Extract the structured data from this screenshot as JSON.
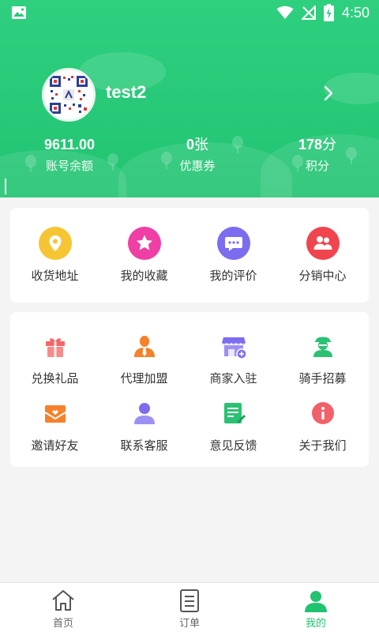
{
  "status_bar": {
    "time": "4:50"
  },
  "profile": {
    "username": "test2"
  },
  "stats": [
    {
      "value": "9611.00",
      "unit": "",
      "label": "账号余额"
    },
    {
      "value": "0",
      "unit": "张",
      "label": "优惠券"
    },
    {
      "value": "178",
      "unit": "分",
      "label": "积分"
    }
  ],
  "menu_primary": [
    {
      "label": "收货地址",
      "icon": "location-icon",
      "color": "#f5c533"
    },
    {
      "label": "我的收藏",
      "icon": "star-icon",
      "color": "#f03fa4"
    },
    {
      "label": "我的评价",
      "icon": "comment-icon",
      "color": "#7b6cf0"
    },
    {
      "label": "分销中心",
      "icon": "users-icon",
      "color": "#f0444f"
    }
  ],
  "menu_secondary": [
    {
      "label": "兑换礼品",
      "icon": "gift-icon",
      "color": "#f66565"
    },
    {
      "label": "代理加盟",
      "icon": "agent-icon",
      "color": "#f5812b"
    },
    {
      "label": "商家入驻",
      "icon": "shop-icon",
      "color": "#7b6cf0"
    },
    {
      "label": "骑手招募",
      "icon": "rider-icon",
      "color": "#2bc173"
    },
    {
      "label": "邀请好友",
      "icon": "invite-mail-icon",
      "color": "#f5812b"
    },
    {
      "label": "联系客服",
      "icon": "service-icon",
      "color": "#7b6cf0"
    },
    {
      "label": "意见反馈",
      "icon": "feedback-icon",
      "color": "#2bc173"
    },
    {
      "label": "关于我们",
      "icon": "info-icon",
      "color": "#f0444f"
    }
  ],
  "bottom_nav": [
    {
      "label": "首页",
      "icon": "home-icon",
      "active": false
    },
    {
      "label": "订单",
      "icon": "order-icon",
      "active": false
    },
    {
      "label": "我的",
      "icon": "user-icon",
      "active": true
    }
  ],
  "colors": {
    "brand": "#20c36f",
    "text": "#333333",
    "background": "#f4f4f4"
  }
}
